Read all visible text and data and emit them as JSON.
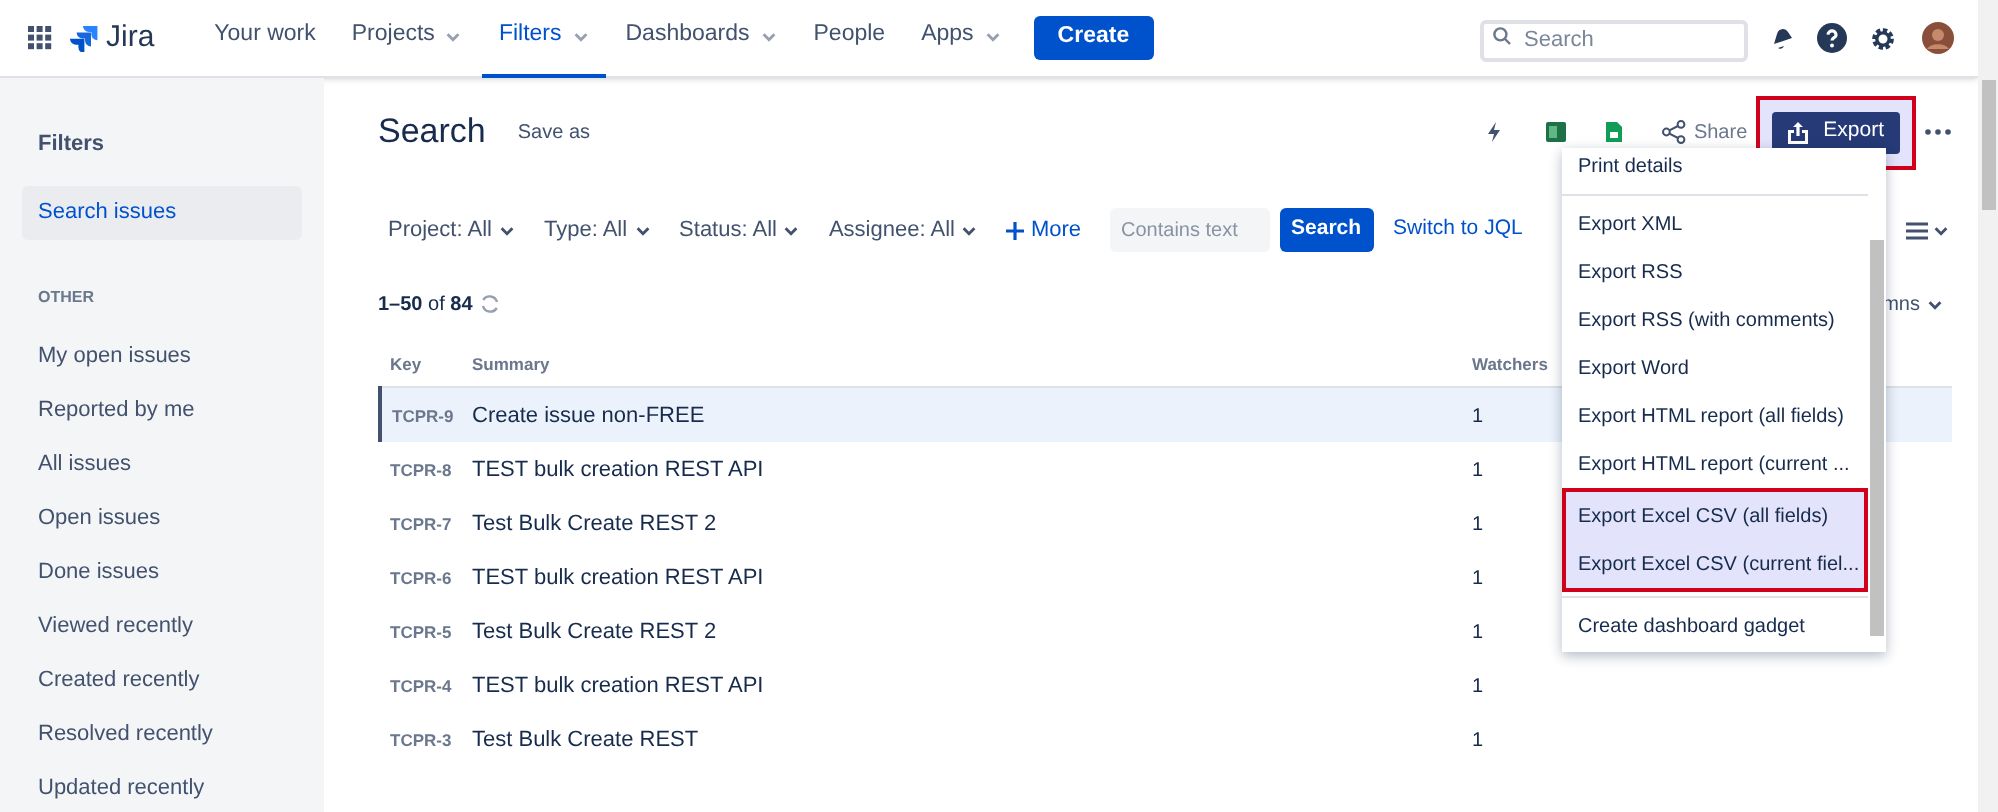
{
  "nav": {
    "product": "Jira",
    "items": [
      {
        "label": "Your work",
        "dropdown": false,
        "selected": false
      },
      {
        "label": "Projects",
        "dropdown": true,
        "selected": false
      },
      {
        "label": "Filters",
        "dropdown": true,
        "selected": true
      },
      {
        "label": "Dashboards",
        "dropdown": true,
        "selected": false
      },
      {
        "label": "People",
        "dropdown": false,
        "selected": false
      },
      {
        "label": "Apps",
        "dropdown": true,
        "selected": false
      }
    ],
    "create": "Create",
    "search": {
      "placeholder": "Search"
    }
  },
  "sidebar": {
    "title": "Filters",
    "items": [
      {
        "label": "Search issues",
        "selected": true
      }
    ],
    "section": "OTHER",
    "other": [
      {
        "label": "My open issues",
        "selected": false
      },
      {
        "label": "Reported by me",
        "selected": false
      },
      {
        "label": "All issues",
        "selected": false
      },
      {
        "label": "Open issues",
        "selected": false
      },
      {
        "label": "Done issues",
        "selected": false
      },
      {
        "label": "Viewed recently",
        "selected": false
      },
      {
        "label": "Created recently",
        "selected": false
      },
      {
        "label": "Resolved recently",
        "selected": false
      },
      {
        "label": "Updated recently",
        "selected": false
      }
    ]
  },
  "page": {
    "title": "Search",
    "save_as": "Save as",
    "share": "Share",
    "export": {
      "label": "Export",
      "highlighted": true
    }
  },
  "filters": {
    "dropdowns": [
      "Project: All",
      "Type: All",
      "Status: All",
      "Assignee: All"
    ],
    "more": "More",
    "text": {
      "placeholder": "Contains text"
    },
    "search": "Search",
    "jql": "Switch to JQL"
  },
  "results": {
    "count_range": "1–50",
    "count_of": "of",
    "count_total": "84",
    "columns_cut": "mns"
  },
  "table": {
    "columns": [
      "Key",
      "Summary",
      "Watchers"
    ],
    "rows": [
      {
        "key": "TCPR-9",
        "summary": "Create issue non-FREE",
        "watchers": "1",
        "selected": true
      },
      {
        "key": "TCPR-8",
        "summary": "TEST bulk creation REST API",
        "watchers": "1",
        "selected": false
      },
      {
        "key": "TCPR-7",
        "summary": "Test Bulk Create REST 2",
        "watchers": "1",
        "selected": false
      },
      {
        "key": "TCPR-6",
        "summary": "TEST bulk creation REST API",
        "watchers": "1",
        "selected": false
      },
      {
        "key": "TCPR-5",
        "summary": "Test Bulk Create REST 2",
        "watchers": "1",
        "selected": false
      },
      {
        "key": "TCPR-4",
        "summary": "TEST bulk creation REST API",
        "watchers": "1",
        "selected": false
      },
      {
        "key": "TCPR-3",
        "summary": "Test Bulk Create REST",
        "watchers": "1",
        "selected": false
      }
    ]
  },
  "export_menu": {
    "groups": [
      [
        {
          "label": "Print details",
          "highlighted": false
        }
      ],
      [
        {
          "label": "Export XML",
          "highlighted": false
        },
        {
          "label": "Export RSS",
          "highlighted": false
        },
        {
          "label": "Export RSS (with comments)",
          "highlighted": false
        },
        {
          "label": "Export Word",
          "highlighted": false
        },
        {
          "label": "Export HTML report (all fields)",
          "highlighted": false
        },
        {
          "label": "Export HTML report (current ...",
          "highlighted": false
        },
        {
          "label": "Export Excel CSV (all fields)",
          "highlighted": true
        },
        {
          "label": "Export Excel CSV (current fiel...",
          "highlighted": true
        }
      ],
      [
        {
          "label": "Create dashboard gadget",
          "highlighted": false
        }
      ]
    ]
  }
}
